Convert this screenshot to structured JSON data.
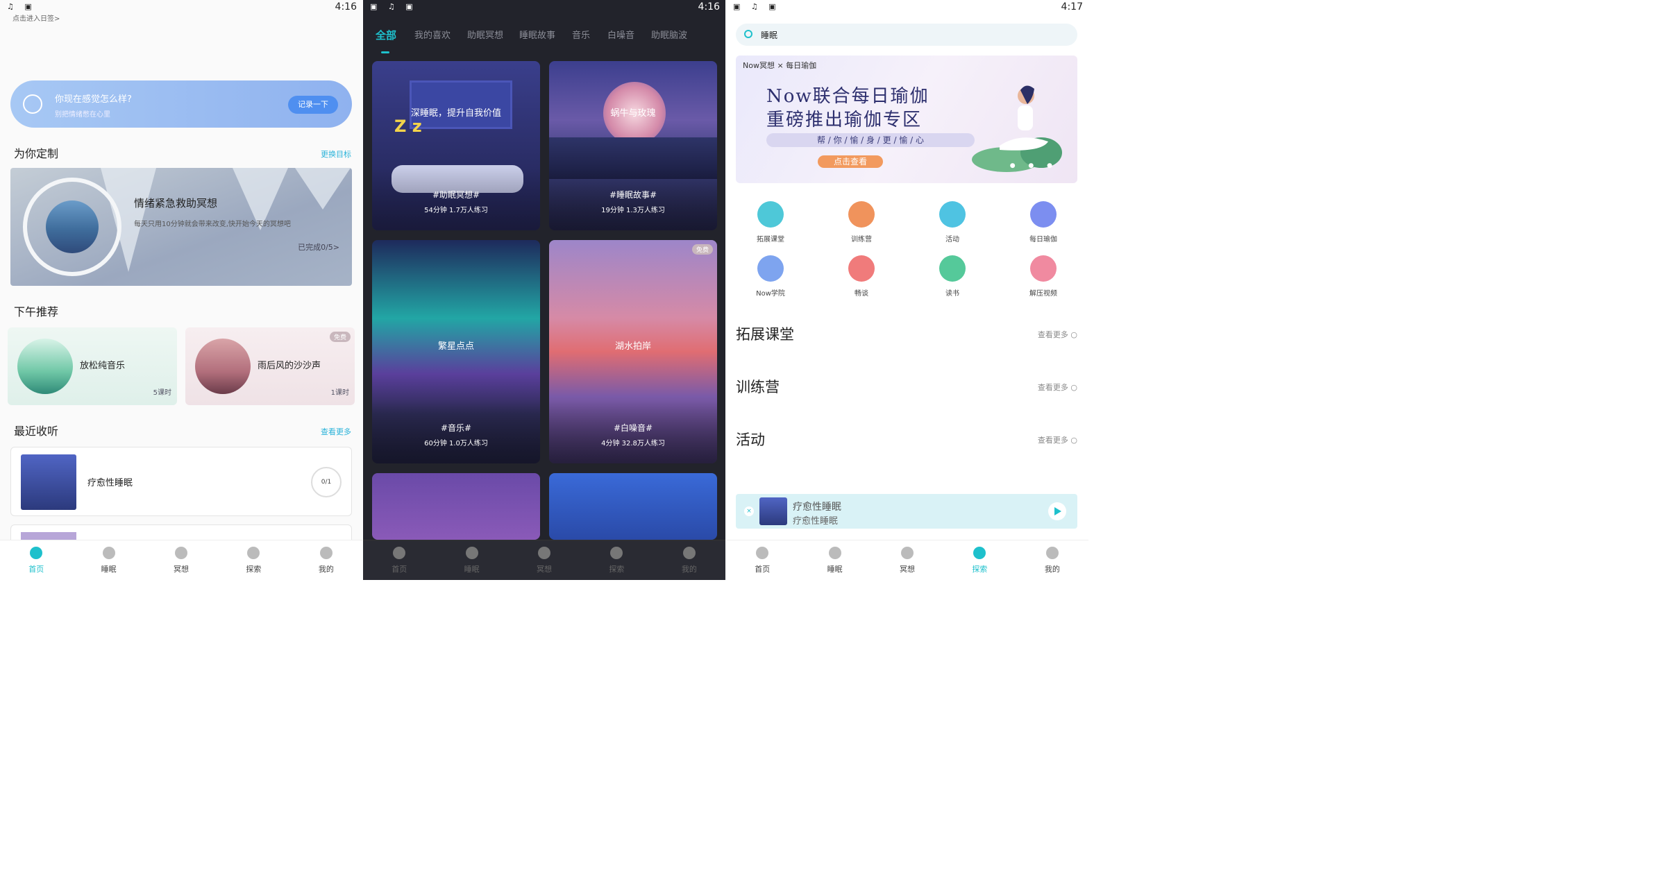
{
  "status": [
    {
      "time": "4:16"
    },
    {
      "time": "4:16"
    },
    {
      "time": "4:17"
    }
  ],
  "p1": {
    "top_hint": "点击进入日签>",
    "mood": {
      "title": "你现在感觉怎么样?",
      "sub": "别把情绪憋在心里",
      "button": "记录一下"
    },
    "custom": {
      "title": "为你定制",
      "link": "更换目标",
      "card_title": "情绪紧急救助冥想",
      "card_desc": "每天只用10分钟就会带来改变,快开始今天的冥想吧",
      "progress": "已完成0/5>"
    },
    "afternoon": {
      "title": "下午推荐",
      "items": [
        {
          "name": "放松纯音乐",
          "count": "5课时"
        },
        {
          "name": "雨后风的沙沙声",
          "count": "1课时",
          "badge": "免费"
        }
      ]
    },
    "recent": {
      "title": "最近收听",
      "link": "查看更多",
      "item": "疗愈性睡眠",
      "progress": "0/1"
    }
  },
  "p2": {
    "tabs": [
      "全部",
      "我的喜欢",
      "助眠冥想",
      "睡眠故事",
      "音乐",
      "白噪音",
      "助眠脑波"
    ],
    "cards": [
      {
        "title": "深睡眠，提升自我价值",
        "tag": "#助眠冥想#",
        "meta": "54分钟 1.7万人练习"
      },
      {
        "title": "蜗牛与玫瑰",
        "tag": "#睡眠故事#",
        "meta": "19分钟 1.3万人练习"
      },
      {
        "title": "繁星点点",
        "tag": "#音乐#",
        "meta": "60分钟 1.0万人练习"
      },
      {
        "title": "湖水拍岸",
        "tag": "#白噪音#",
        "meta": "4分钟 32.8万人练习",
        "badge": "免费"
      }
    ]
  },
  "p3": {
    "search": "睡眠",
    "banner": {
      "brand": "Now冥想 × 每日瑜伽",
      "line1": "Now联合每日瑜伽",
      "line2": "重磅推出瑜伽专区",
      "line3": "帮 / 你 / 愉 / 身 / 更 / 愉 / 心",
      "button": "点击查看"
    },
    "grid": [
      {
        "label": "拓展课堂",
        "color": "#4ec8d8"
      },
      {
        "label": "训练营",
        "color": "#f0935c"
      },
      {
        "label": "活动",
        "color": "#4fc3e2"
      },
      {
        "label": "每日瑜伽",
        "color": "#7c8ef0"
      },
      {
        "label": "Now学院",
        "color": "#7ea4ef"
      },
      {
        "label": "畅谈",
        "color": "#f07b7b"
      },
      {
        "label": "读书",
        "color": "#55c99a"
      },
      {
        "label": "解压视频",
        "color": "#f08aa0"
      }
    ],
    "sections": [
      {
        "title": "拓展课堂",
        "more": "查看更多 ○"
      },
      {
        "title": "训练营",
        "more": "查看更多 ○"
      },
      {
        "title": "活动",
        "more": "查看更多 ○"
      }
    ],
    "player": {
      "title": "疗愈性睡眠",
      "sub": "疗愈性睡眠"
    }
  },
  "tabbar": [
    "首页",
    "睡眠",
    "冥想",
    "探索",
    "我的"
  ]
}
